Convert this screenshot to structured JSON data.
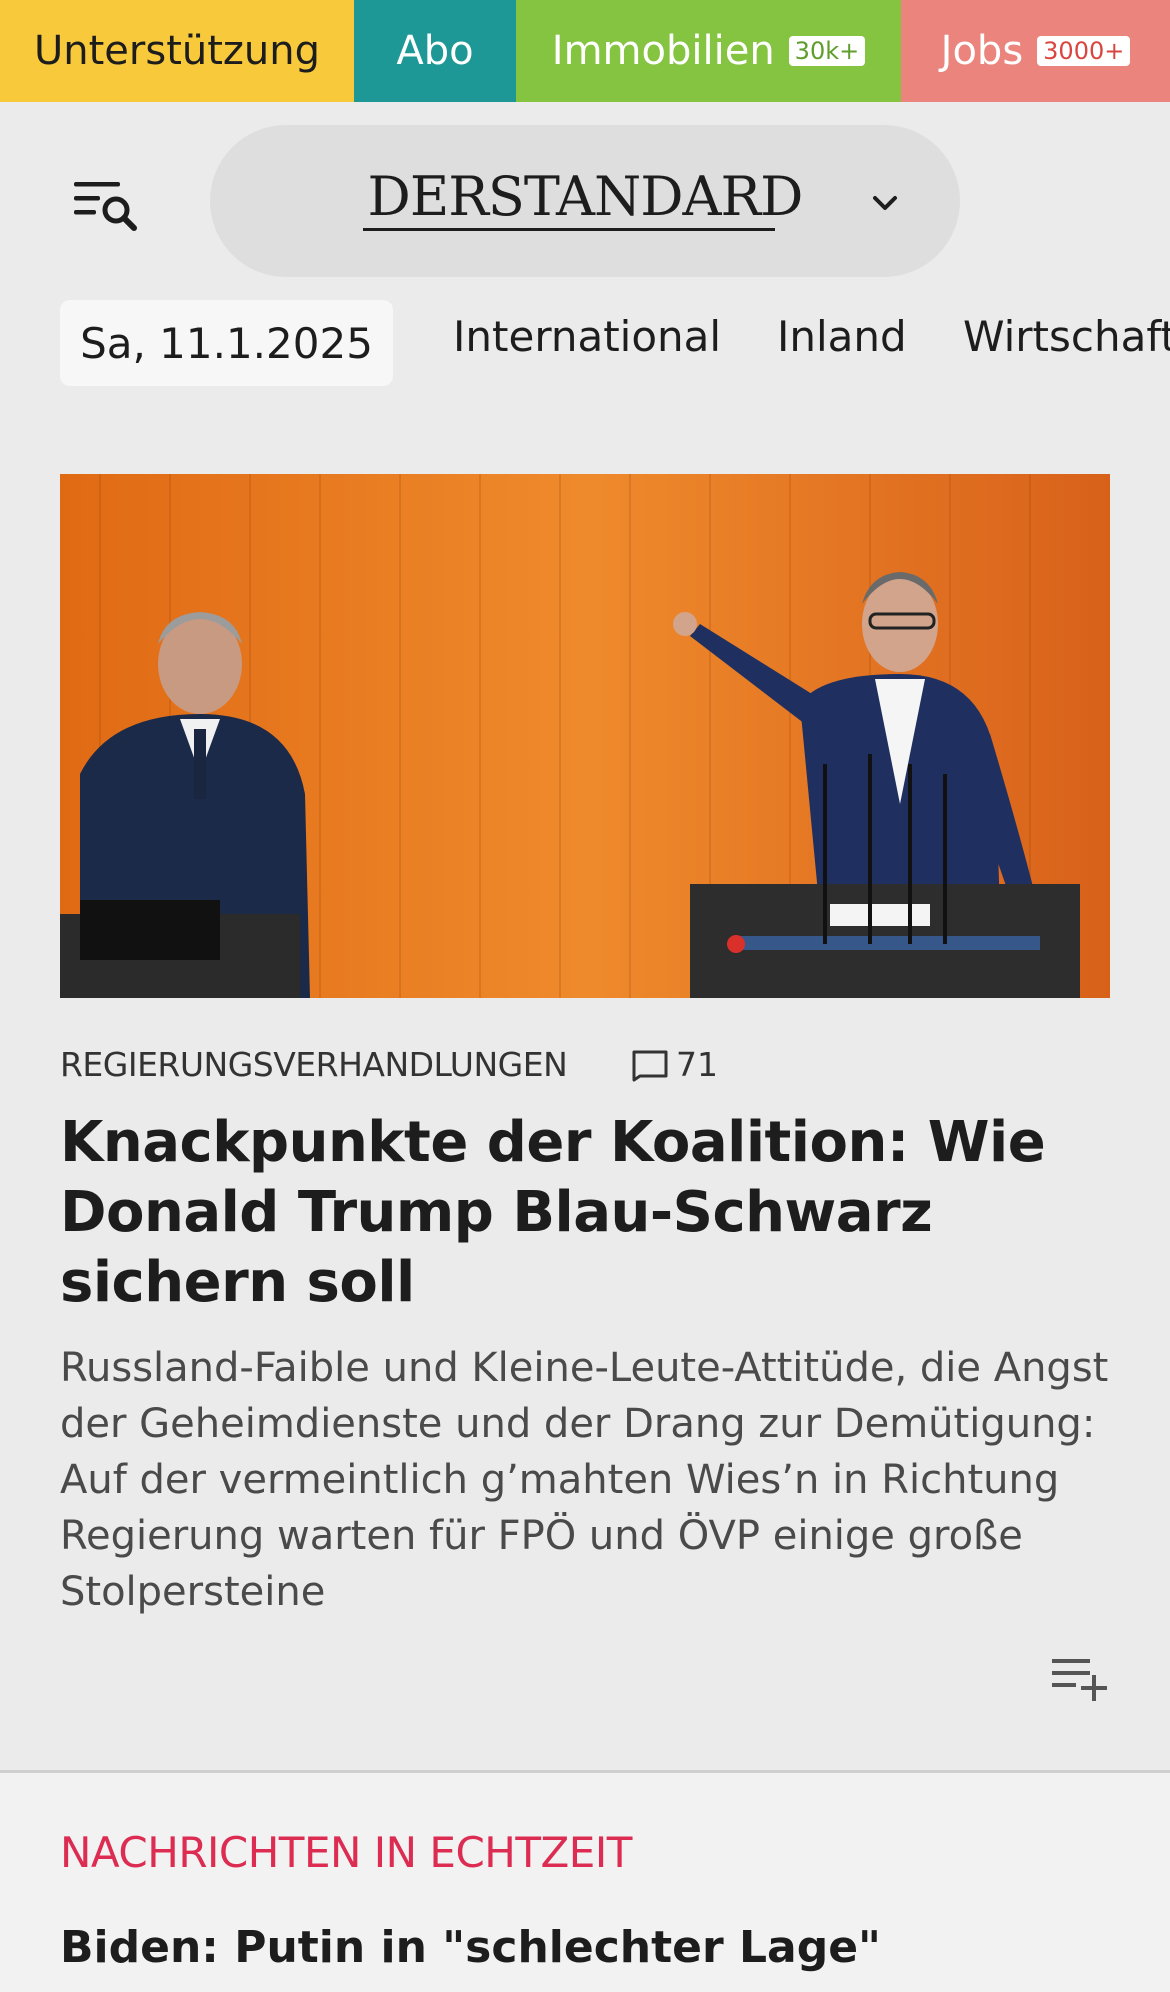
{
  "servicebar": {
    "support": {
      "label": "Unterstützung"
    },
    "abo": {
      "label": "Abo"
    },
    "immobilien": {
      "label": "Immobilien",
      "badge": "30k+"
    },
    "jobs": {
      "label": "Jobs",
      "badge": "3000+"
    }
  },
  "header": {
    "logo": {
      "part1": "DER",
      "part2": "STANDARD"
    },
    "menu_icon": "menu-search-icon",
    "chevron_icon": "chevron-down-icon"
  },
  "nav": {
    "date": "Sa, 11.1.2025",
    "items": [
      "International",
      "Inland",
      "Wirtschaft"
    ]
  },
  "article": {
    "kicker": "REGIERUNGSVERHANDLUNGEN",
    "comment_count": "71",
    "headline": "Knackpunkte der Koalition: Wie Donald Trump Blau-Schwarz sichern soll",
    "teaser": "Russland-Faible und Kleine-Leute-Attitüde, die Angst der Geheimdienste und der Drang zur Demütigung: Auf der vermeintlich g’mahten Wies’n in Richtung Regierung warten für FPÖ und ÖVP einige große Stolpersteine",
    "image_icon": "photo-parliament",
    "add_icon": "add-to-list-icon"
  },
  "live_section": {
    "title": "NACHRICHTEN IN ECHTZEIT",
    "headline": "Biden: Putin in \"schlechter Lage\""
  },
  "colors": {
    "support": "#f8c93b",
    "abo": "#1d9896",
    "immobilien": "#84c441",
    "jobs": "#ea847d",
    "section_accent": "#dc2c51",
    "background": "#ebebeb"
  }
}
